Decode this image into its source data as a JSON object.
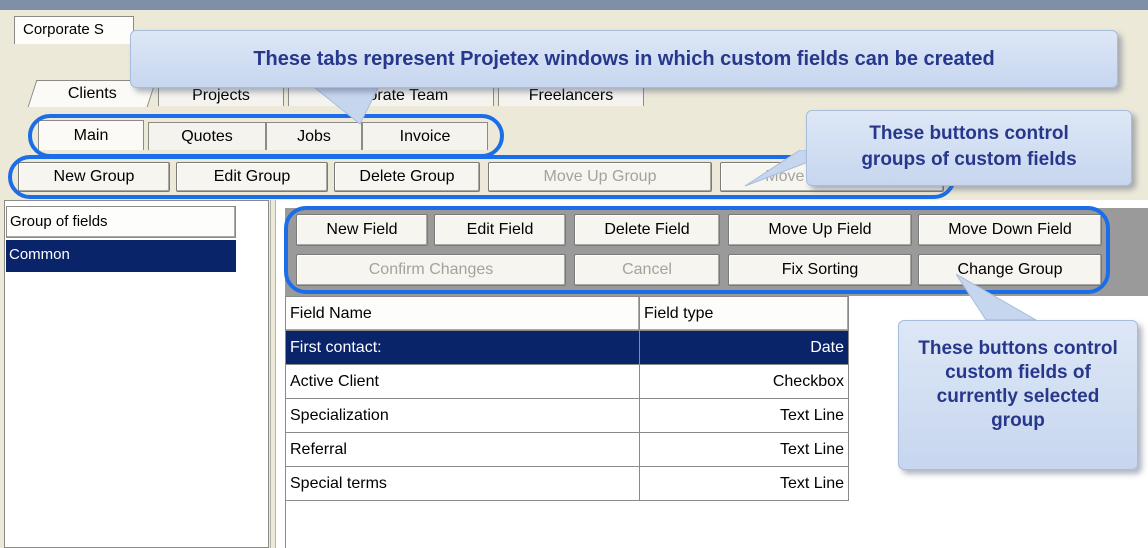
{
  "window_tab": {
    "label": "Corporate S"
  },
  "windows_tabs": [
    {
      "label": "Clients"
    },
    {
      "label": "Projects"
    },
    {
      "label": "Corporate Team"
    },
    {
      "label": "Freelancers"
    }
  ],
  "subtabs": [
    {
      "label": "Main"
    },
    {
      "label": "Quotes"
    },
    {
      "label": "Jobs"
    },
    {
      "label": "Invoice"
    }
  ],
  "group_toolbar": {
    "new_group": "New Group",
    "edit_group": "Edit Group",
    "delete_group": "Delete Group",
    "move_up_group": "Move Up Group",
    "move_down_group": "Move Down Group"
  },
  "groups_panel": {
    "header": "Group of fields",
    "items": [
      {
        "label": "Common",
        "selected": true
      }
    ]
  },
  "field_toolbar": {
    "new_field": "New Field",
    "edit_field": "Edit Field",
    "delete_field": "Delete Field",
    "move_up_field": "Move Up Field",
    "move_down_field": "Move Down Field",
    "confirm_changes": "Confirm Changes",
    "cancel": "Cancel",
    "fix_sorting": "Fix Sorting",
    "change_group": "Change Group"
  },
  "fields_table": {
    "columns": [
      "Field Name",
      "Field type"
    ],
    "rows": [
      {
        "name": "First contact:",
        "type": "Date",
        "selected": true
      },
      {
        "name": "Active Client",
        "type": "Checkbox"
      },
      {
        "name": "Specialization",
        "type": "Text Line"
      },
      {
        "name": "Referral",
        "type": "Text Line"
      },
      {
        "name": "Special terms",
        "type": "Text Line"
      }
    ]
  },
  "callouts": {
    "tabs": "These tabs represent Projetex windows in which custom fields can be created",
    "group_buttons": "These buttons control groups of custom fields",
    "field_buttons": "These buttons control custom fields of currently selected group"
  },
  "colors": {
    "selection": "#0a246a",
    "callout_text": "#27388c",
    "highlight_ring": "#1c6ee8",
    "window_bg": "#ece9d8"
  }
}
